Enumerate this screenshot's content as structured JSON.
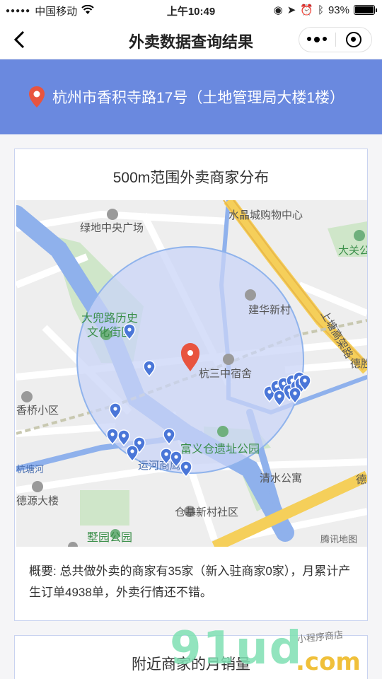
{
  "status_bar": {
    "carrier": "中国移动",
    "time": "上午10:49",
    "battery": "93%"
  },
  "nav": {
    "title": "外卖数据查询结果"
  },
  "banner": {
    "address": "杭州市香积寺路17号（土地管理局大楼1楼）"
  },
  "card": {
    "title": "500m范围外卖商家分布",
    "summary": "概要: 总共做外卖的商家有35家（新入驻商家0家），月累计产生订单4938单，外卖行情还不错。"
  },
  "map": {
    "labels": {
      "plaza": "绿地中央广场",
      "crystal": "水晶城购物中心",
      "daguan": "大关公",
      "jianhua": "建华新村",
      "dadou": "大兜路历史",
      "wenhua": "文化街区",
      "school": "杭三中宿舍",
      "shangtang": "上塘高架路",
      "deshe": "德胜",
      "xiangqiao": "香桥小区",
      "fuyi": "富义仓遗址公园",
      "yunhe": "运河商鹰",
      "canal": "杭塘河",
      "qingshui": "清水公寓",
      "deyuan": "德源大楼",
      "cangji": "仓基新村社区",
      "shuyuan": "墅园公园",
      "de2": "德",
      "tencent": "腾讯地图"
    },
    "center_pin_color": "#e8543f",
    "merchant_pin_color": "#4a76d8",
    "radius_fill": "#c9d4f7"
  },
  "card2": {
    "title": "附近商家的月销量"
  },
  "watermark": {
    "big": "91ud",
    "com": ".com",
    "small": "小程序商店"
  }
}
